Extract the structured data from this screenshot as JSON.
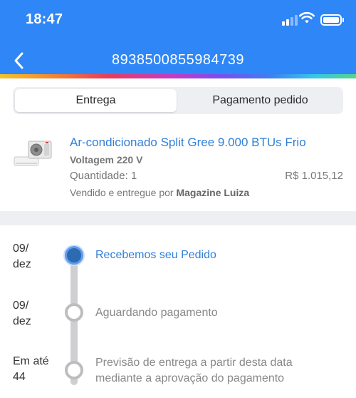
{
  "status_bar": {
    "time": "18:47"
  },
  "header": {
    "title": "8938500855984739",
    "back_icon": "chevron-left-icon"
  },
  "tabs": [
    {
      "label": "Entrega",
      "active": true
    },
    {
      "label": "Pagamento pedido",
      "active": false
    }
  ],
  "product": {
    "name": "Ar-condicionado Split Gree 9.000 BTUs Frio",
    "voltage": "Voltagem 220 V",
    "quantity": "Quantidade: 1",
    "price": "R$ 1.015,12",
    "seller_prefix": "Vendido e entregue por",
    "seller_name": "Magazine Luiza",
    "image_icon": "air-conditioner-icon"
  },
  "timeline": [
    {
      "date_line1": "09/",
      "date_line2": "dez",
      "text_line1": "Recebemos seu Pedido",
      "text_line2": "",
      "status": "active"
    },
    {
      "date_line1": "09/",
      "date_line2": "dez",
      "text_line1": "Aguardando pagamento",
      "text_line2": "",
      "status": "pending"
    },
    {
      "date_line1": "Em até",
      "date_line2": "44",
      "text_line1": "Previsão de entrega a partir desta data",
      "text_line2": "mediante a aprovação do pagamento",
      "status": "pending"
    }
  ],
  "colors": {
    "header_bg": "#2f86f6",
    "link_blue": "#2f7fd8",
    "active_node": "#2c6ab1"
  }
}
